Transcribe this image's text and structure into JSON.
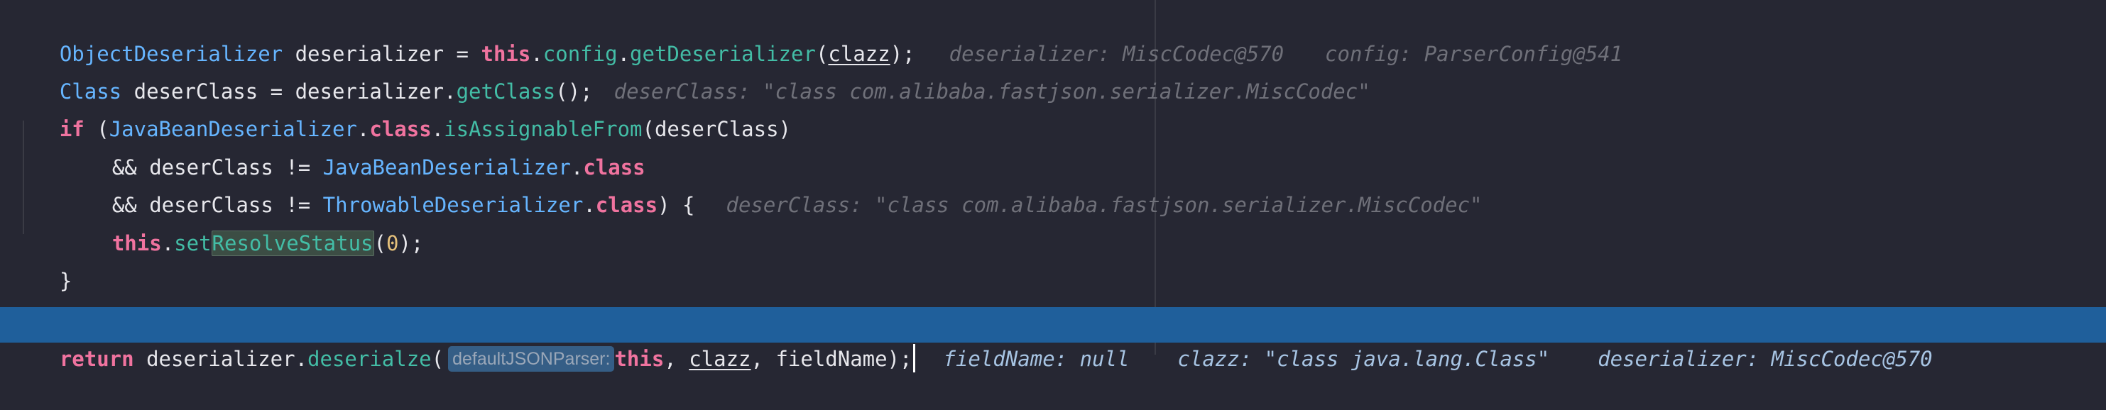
{
  "code": {
    "line1": {
      "type": "ObjectDeserializer",
      "var": " deserializer = ",
      "kw": "this",
      "dot1": ".",
      "field": "config",
      "dot2": ".",
      "method": "getDeserializer",
      "open": "(",
      "arg": "clazz",
      "close": ");",
      "hint1": "deserializer: MiscCodec@570",
      "hint2": "config: ParserConfig@541"
    },
    "line2": {
      "type": "Class",
      "var": " deserClass = deserializer.",
      "method": "getClass",
      "close": "();",
      "hint": "deserClass: \"class com.alibaba.fastjson.serializer.MiscCodec\""
    },
    "line3": {
      "kw": "if",
      "open": " (",
      "type": "JavaBeanDeserializer",
      "dot": ".",
      "kw2": "class",
      "dot2": ".",
      "method": "isAssignableFrom",
      "arg": "(deserClass)"
    },
    "line4": {
      "ops": "&& deserClass != ",
      "type": "JavaBeanDeserializer",
      "dot": ".",
      "kw": "class"
    },
    "line5": {
      "ops": "&& deserClass != ",
      "type": "ThrowableDeserializer",
      "dot": ".",
      "kw": "class",
      "close": ") {",
      "hint": "deserClass: \"class com.alibaba.fastjson.serializer.MiscCodec\""
    },
    "line6": {
      "kw": "this",
      "dot": ".",
      "method_a": "set",
      "method_b": "ResolveStatus",
      "open": "(",
      "num": "0",
      "close": ");"
    },
    "line7": {
      "brace": "}"
    },
    "line8": {
      "kw": "return",
      "var": " deserializer.",
      "method": "deserialze",
      "open": "(",
      "param_hint": "defaultJSONParser:",
      "kw2": "this",
      "comma1": ", ",
      "arg1": "clazz",
      "comma2": ", fieldName);",
      "hint1": "fieldName: null",
      "hint2": "clazz: \"class java.lang.Class\"",
      "hint3": "deserializer: MiscCodec@570"
    }
  },
  "colors": {
    "background": "#262733",
    "execution_line": "#1f5f9b",
    "keyword": "#f0739f",
    "type": "#66b5ff",
    "method": "#43bda6",
    "hint": "#6f7079"
  }
}
